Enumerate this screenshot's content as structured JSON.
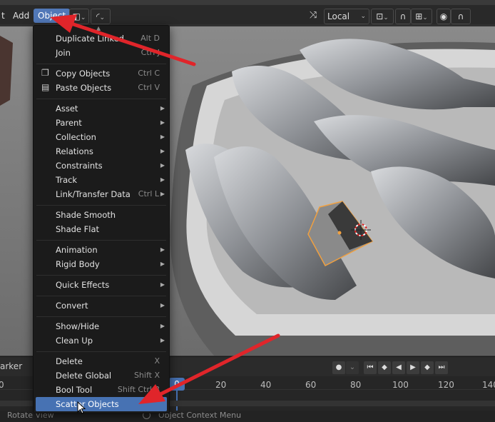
{
  "header": {
    "menu_partial": "t",
    "menu_add": "Add",
    "menu_object": "Object",
    "orientation": "Local"
  },
  "object_menu": {
    "items": [
      {
        "label": "Duplicate Linked",
        "shortcut": "Alt D"
      },
      {
        "label": "Join",
        "shortcut": "Ctrl J"
      },
      {
        "label": "Copy Objects",
        "shortcut": "Ctrl C",
        "icon": "copy-icon"
      },
      {
        "label": "Paste Objects",
        "shortcut": "Ctrl V",
        "icon": "paste-icon"
      },
      {
        "label": "Asset"
      },
      {
        "label": "Parent"
      },
      {
        "label": "Collection"
      },
      {
        "label": "Relations"
      },
      {
        "label": "Constraints"
      },
      {
        "label": "Track"
      },
      {
        "label": "Link/Transfer Data",
        "shortcut": "Ctrl L"
      },
      {
        "label": "Shade Smooth"
      },
      {
        "label": "Shade Flat"
      },
      {
        "label": "Animation"
      },
      {
        "label": "Rigid Body"
      },
      {
        "label": "Quick Effects"
      },
      {
        "label": "Convert"
      },
      {
        "label": "Show/Hide"
      },
      {
        "label": "Clean Up"
      },
      {
        "label": "Delete",
        "shortcut": "X"
      },
      {
        "label": "Delete Global",
        "shortcut": "Shift X"
      },
      {
        "label": "Bool Tool",
        "shortcut": "Shift Ctrl B"
      },
      {
        "label": "Scatter Objects"
      }
    ]
  },
  "timeline": {
    "marker_label": "arker",
    "current_frame": "0",
    "ticks": [
      "0",
      "20",
      "40",
      "60",
      "80",
      "100",
      "120",
      "140"
    ]
  },
  "statusbar": {
    "left": "Rotate View",
    "right": "Object Context Menu"
  },
  "colors": {
    "highlight": "#4772b3",
    "annotation_arrow": "#e0252a",
    "selection": "#f0a040"
  }
}
